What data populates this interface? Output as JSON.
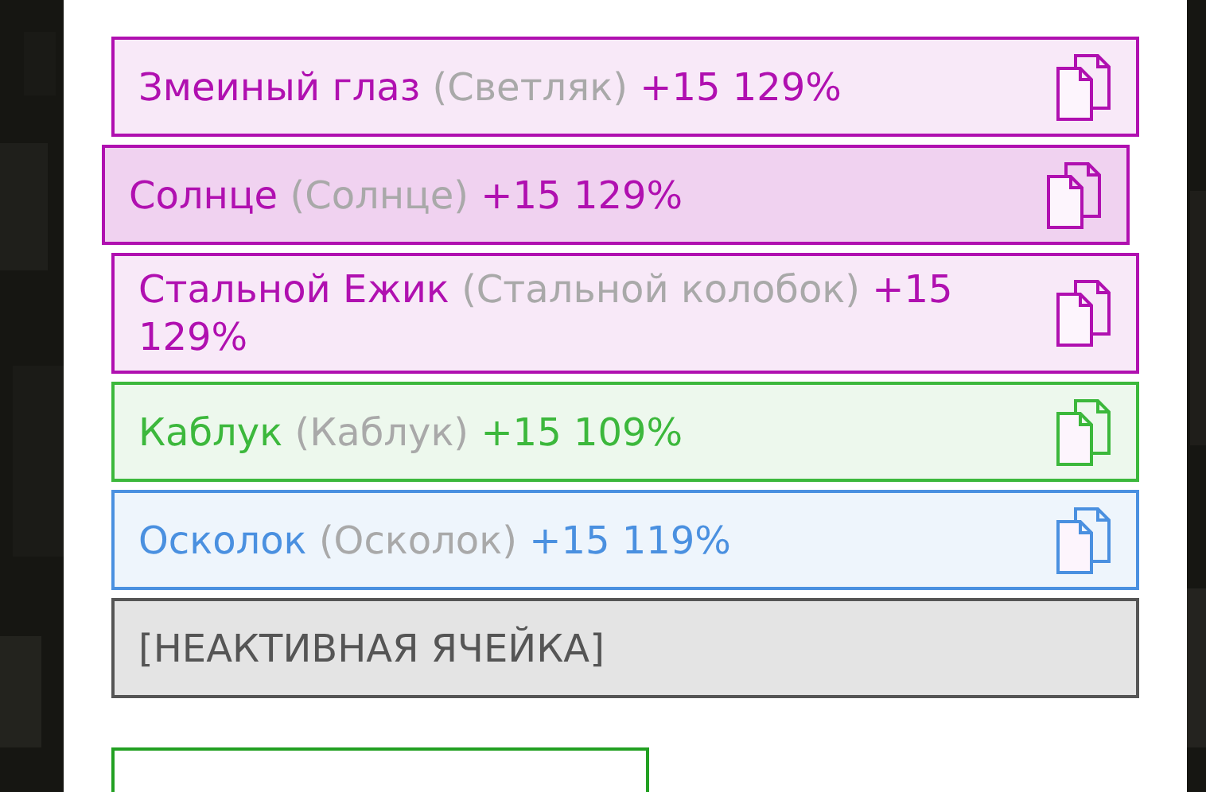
{
  "items": [
    {
      "kind": "item",
      "name": "Змеиный глаз",
      "alias": "(Светляк)",
      "bonus": "+15 129%",
      "color": "#b010b0",
      "selected": false
    },
    {
      "kind": "item",
      "name": "Солнце",
      "alias": "(Солнце)",
      "bonus": "+15 129%",
      "color": "#b010b0",
      "selected": true
    },
    {
      "kind": "item",
      "name": "Стальной Ежик",
      "alias": "(Стальной колобок)",
      "bonus": "+15 129%",
      "color": "#b010b0",
      "selected": false
    },
    {
      "kind": "item",
      "name": "Каблук",
      "alias": "(Каблук)",
      "bonus": "+15 109%",
      "color": "#3cb83c",
      "selected": false
    },
    {
      "kind": "item",
      "name": "Осколок",
      "alias": "(Осколок)",
      "bonus": "+15 119%",
      "color": "#4a90e0",
      "selected": false
    },
    {
      "kind": "inactive",
      "name": "[НЕАКТИВНАЯ ЯЧЕЙКА]",
      "color": "#555555",
      "selected": false
    }
  ]
}
